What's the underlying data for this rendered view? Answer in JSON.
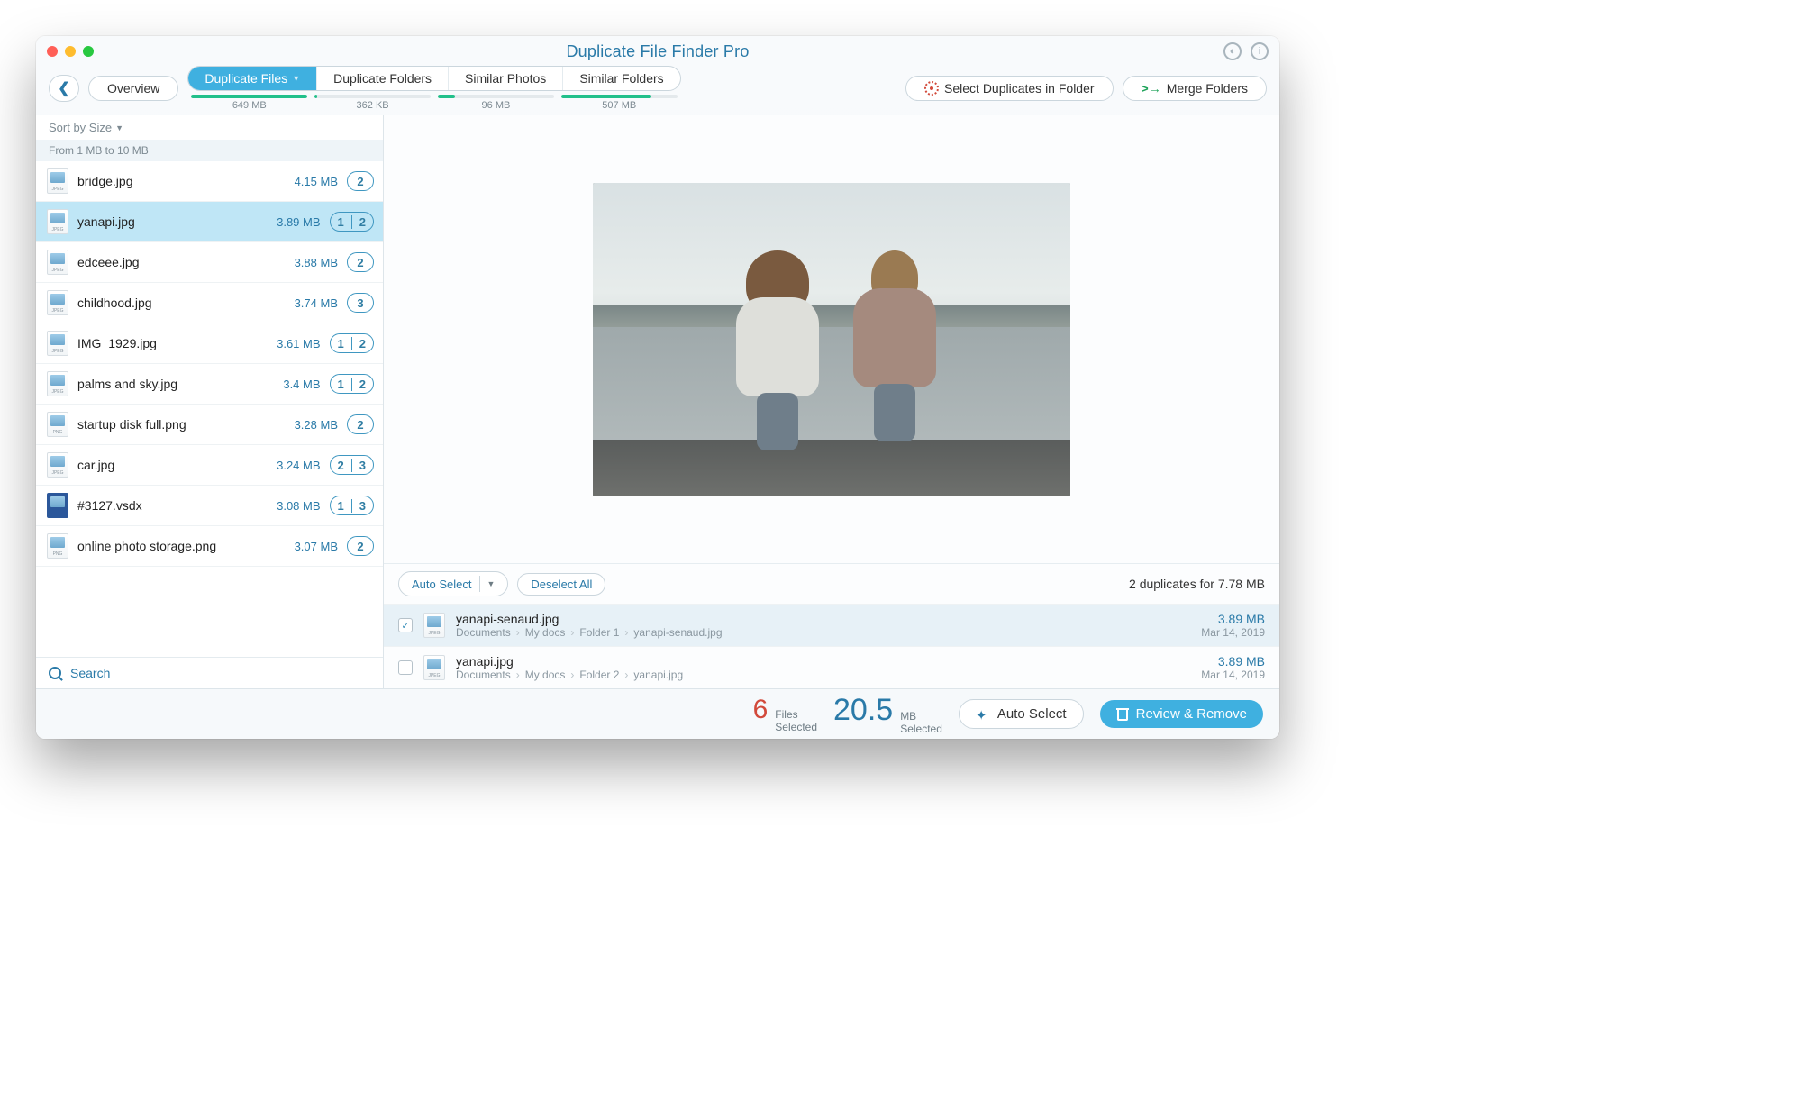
{
  "title": "Duplicate File Finder Pro",
  "toolbar": {
    "overview": "Overview",
    "tabs": {
      "dup_files": "Duplicate Files",
      "dup_folders": "Duplicate Folders",
      "similar_photos": "Similar Photos",
      "similar_folders": "Similar Folders"
    },
    "sizes": {
      "dup_files": "649 MB",
      "dup_folders": "362 KB",
      "similar_photos": "96 MB",
      "similar_folders": "507 MB"
    },
    "select_in_folder": "Select Duplicates in Folder",
    "merge_folders": "Merge Folders"
  },
  "sidebar": {
    "sort_label": "Sort by Size",
    "group_header": "From 1 MB to 10 MB",
    "files": [
      {
        "name": "bridge.jpg",
        "size": "4.15 MB",
        "type": "jpeg",
        "count": "2"
      },
      {
        "name": "yanapi.jpg",
        "size": "3.89 MB",
        "type": "jpeg",
        "split": [
          "1",
          "2"
        ],
        "selected": true
      },
      {
        "name": "edceee.jpg",
        "size": "3.88 MB",
        "type": "jpeg",
        "count": "2"
      },
      {
        "name": "childhood.jpg",
        "size": "3.74 MB",
        "type": "jpeg",
        "count": "3"
      },
      {
        "name": "IMG_1929.jpg",
        "size": "3.61 MB",
        "type": "jpeg",
        "split": [
          "1",
          "2"
        ]
      },
      {
        "name": "palms and sky.jpg",
        "size": "3.4 MB",
        "type": "jpeg",
        "split": [
          "1",
          "2"
        ]
      },
      {
        "name": "startup disk full.png",
        "size": "3.28 MB",
        "type": "png",
        "count": "2"
      },
      {
        "name": "car.jpg",
        "size": "3.24 MB",
        "type": "jpeg",
        "split": [
          "2",
          "3"
        ]
      },
      {
        "name": "#3127.vsdx",
        "size": "3.08 MB",
        "type": "vsdx",
        "split": [
          "1",
          "3"
        ]
      },
      {
        "name": "online photo storage.png",
        "size": "3.07 MB",
        "type": "png",
        "count": "2"
      }
    ],
    "search": "Search"
  },
  "detail": {
    "auto_select": "Auto Select",
    "deselect_all": "Deselect All",
    "summary": "2 duplicates for 7.78 MB",
    "dups": [
      {
        "checked": true,
        "name": "yanapi-senaud.jpg",
        "path": [
          "Documents",
          "My docs",
          "Folder 1",
          "yanapi-senaud.jpg"
        ],
        "size": "3.89 MB",
        "date": "Mar 14, 2019"
      },
      {
        "checked": false,
        "name": "yanapi.jpg",
        "path": [
          "Documents",
          "My docs",
          "Folder 2",
          "yanapi.jpg"
        ],
        "size": "3.89 MB",
        "date": "Mar 14, 2019"
      }
    ]
  },
  "footer": {
    "files_count": "6",
    "files_label1": "Files",
    "files_label2": "Selected",
    "mb_count": "20.5",
    "mb_label1": "MB",
    "mb_label2": "Selected",
    "auto_select": "Auto Select",
    "review": "Review & Remove"
  }
}
